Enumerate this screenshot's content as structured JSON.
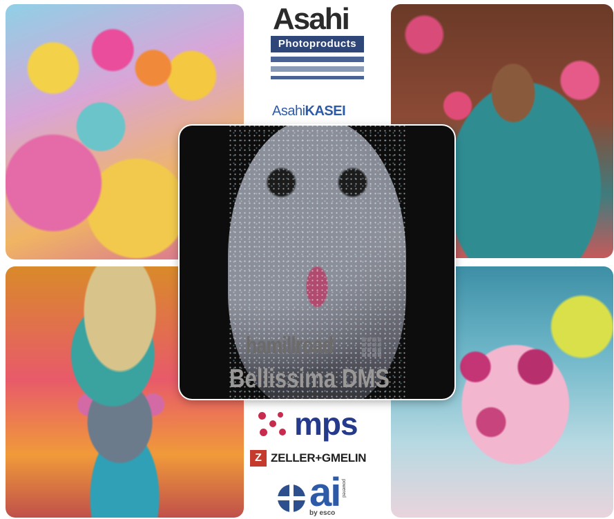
{
  "logos": {
    "asahi": {
      "word": "Asahi",
      "sub": "Photoproducts"
    },
    "asahikasei": {
      "part1": "Asahi",
      "part2": "KASEI"
    },
    "mps": {
      "word": "mps"
    },
    "zeller": {
      "word": "ZELLER+GMELIN",
      "mark": "Z"
    },
    "ai": {
      "word": "ai",
      "by": "by esco",
      "vertical": "powered"
    }
  },
  "center": {
    "brand": "hamillroad",
    "product": "Bellissima DMS"
  },
  "colors": {
    "asahi_blue": "#2f4778",
    "kasei_blue": "#2e5ba8",
    "mps_red": "#c72c4e",
    "mps_navy": "#253a8a",
    "zeller_red": "#c43a2c"
  }
}
